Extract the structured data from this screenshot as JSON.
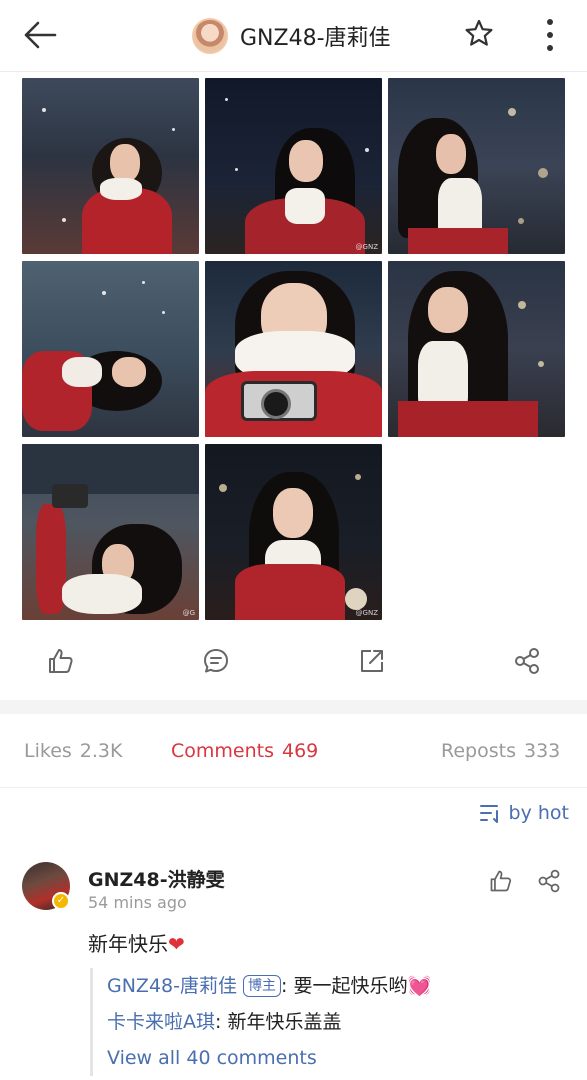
{
  "header": {
    "title": "GNZ48-唐莉佳",
    "back_icon": "arrow-left-icon",
    "favorite_icon": "star-icon",
    "more_icon": "more-vertical-icon"
  },
  "photos": [
    {
      "watermark": ""
    },
    {
      "watermark": "@GNZ"
    },
    {
      "watermark": ""
    },
    {
      "watermark": ""
    },
    {
      "watermark": ""
    },
    {
      "watermark": ""
    },
    {
      "watermark": "@G"
    },
    {
      "watermark": "@GNZ"
    }
  ],
  "action_bar": {
    "like_icon": "thumbs-up-icon",
    "comment_icon": "comment-icon",
    "repost_icon": "repost-icon",
    "share_icon": "share-icon"
  },
  "tabs": {
    "likes": {
      "label": "Likes",
      "count": "2.3K"
    },
    "comments": {
      "label": "Comments",
      "count": "469"
    },
    "reposts": {
      "label": "Reposts",
      "count": "333"
    }
  },
  "sort": {
    "label": "by hot",
    "icon": "sort-icon"
  },
  "comment": {
    "user": "GNZ48-洪静雯",
    "time": "54  mins ago",
    "text": "新年快乐",
    "emoji": "❤",
    "replies": [
      {
        "user": "GNZ48-唐莉佳",
        "badge": "博主",
        "text": ": 要一起快乐哟",
        "emoji": "💓"
      },
      {
        "user": "卡卡来啦A琪",
        "text": ": 新年快乐盖盖"
      }
    ],
    "view_all": "View all 40 comments"
  },
  "colors": {
    "accent_red": "#d9363e",
    "link_blue": "#4a6fb0",
    "muted": "#9a9a9a"
  }
}
